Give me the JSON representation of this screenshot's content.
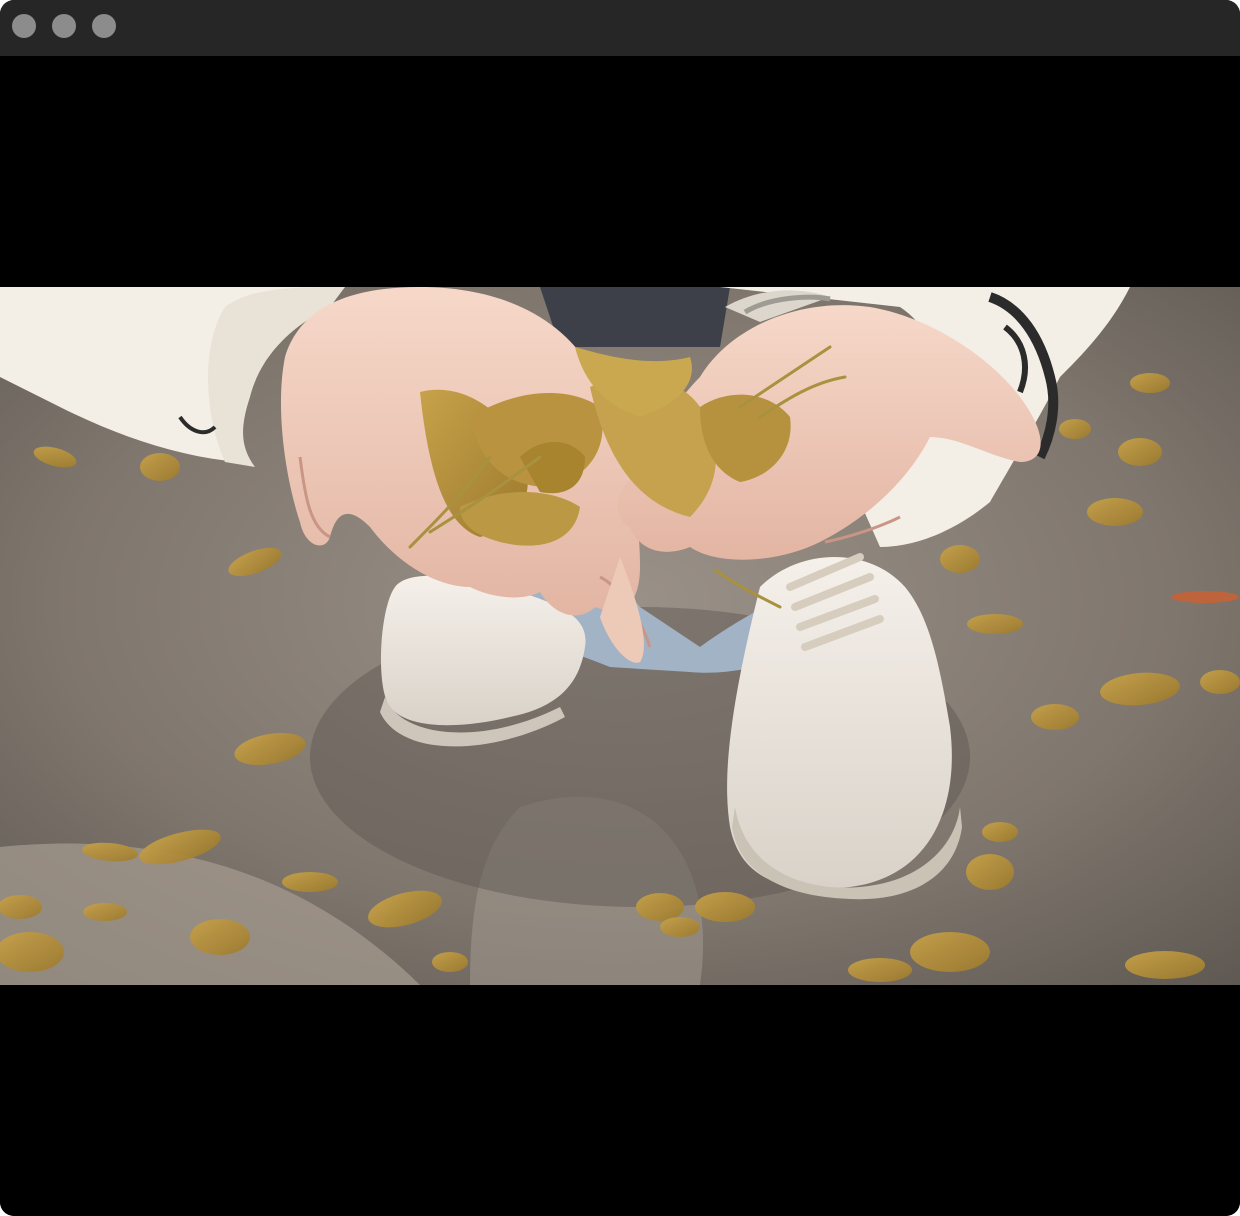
{
  "window": {
    "controls": [
      "close",
      "minimize",
      "zoom"
    ],
    "background": "#000000",
    "titlebar_color": "#262626",
    "control_color": "#8c8c8c"
  },
  "video": {
    "icon": "photo-frame-icon"
  }
}
